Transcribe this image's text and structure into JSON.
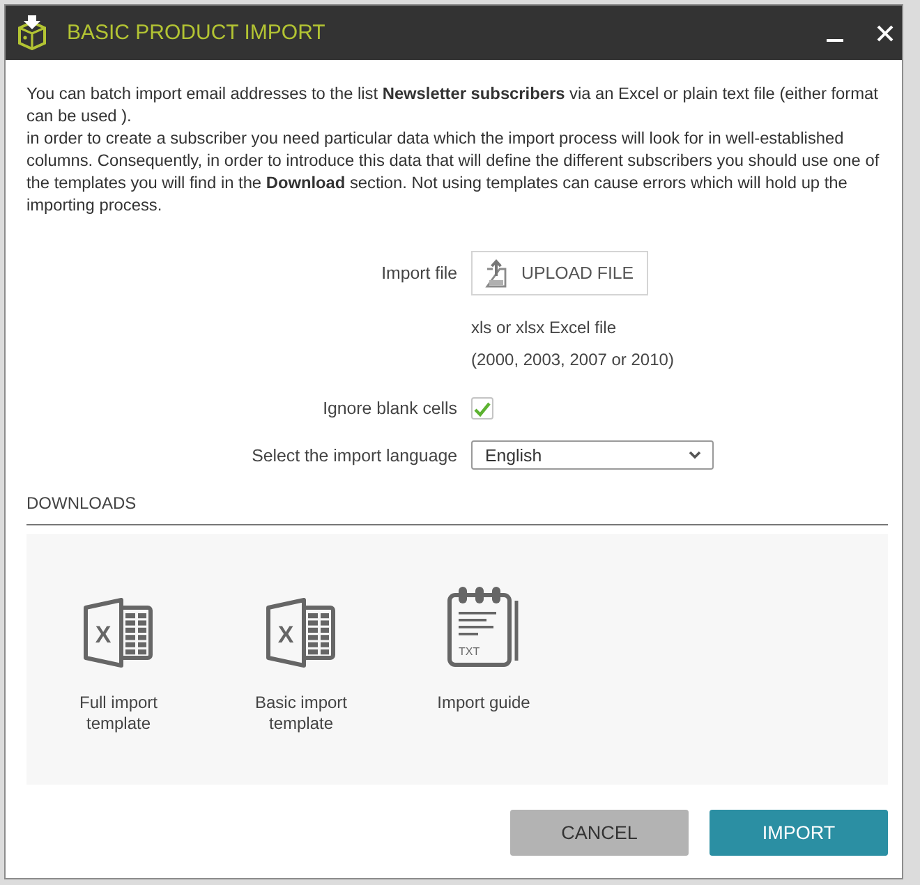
{
  "window": {
    "title": "BASIC PRODUCT IMPORT"
  },
  "intro": [
    "You can batch import email addresses to the list **Newsletter subscribers** via an Excel or plain text file (either format can be used ).",
    "in order to create a subscriber you need particular data which the import process will look for in well-established columns. Consequently, in order to introduce this data that will define the different subscribers you should use one of the templates you will find in the **Download** section. Not using templates can cause errors which will hold up the importing process."
  ],
  "form": {
    "import_file": {
      "label": "Import file",
      "button": "UPLOAD FILE",
      "hints": [
        "xls or xlsx Excel file",
        "(2000, 2003, 2007 or 2010)"
      ]
    },
    "ignore_blank": {
      "label": "Ignore blank cells",
      "checked": true
    },
    "language": {
      "label": "Select the import language",
      "value": "English"
    }
  },
  "downloads": {
    "title": "DOWNLOADS",
    "items": [
      {
        "kind": "spreadsheet",
        "badge": "X",
        "label": "Full import template"
      },
      {
        "kind": "spreadsheet",
        "badge": "X",
        "label": "Basic import template"
      },
      {
        "kind": "text-document",
        "badge": "TXT",
        "label": "Import guide"
      }
    ]
  },
  "buttons": [
    {
      "kind": "secondary",
      "label": "CANCEL"
    },
    {
      "kind": "primary",
      "label": "IMPORT"
    }
  ]
}
